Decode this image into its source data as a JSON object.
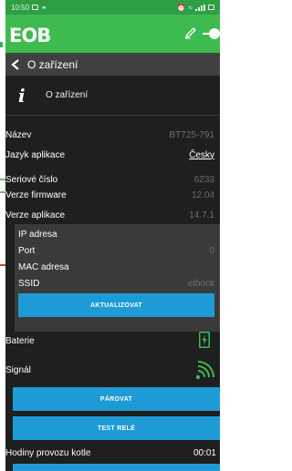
{
  "statusbar": {
    "time": "10:50"
  },
  "appbar": {
    "logo": "EOB"
  },
  "titlebar": {
    "title": "O zařízení"
  },
  "section": {
    "label": "O zařízení"
  },
  "info_rows": [
    {
      "key": "Název",
      "value": "BT725-791"
    },
    {
      "key": "Jazyk aplikace",
      "value": "Česky"
    },
    {
      "key": "Seriové číslo",
      "value": "6233"
    },
    {
      "key": "Verze firmware",
      "value": "12.04"
    },
    {
      "key": "Verze aplikace",
      "value": "14.7.1"
    }
  ],
  "network": {
    "ip_label": "IP adresa",
    "ip_value": "",
    "port_label": "Port",
    "port_value": "0",
    "mac_label": "MAC adresa",
    "mac_value": "",
    "ssid_label": "SSID",
    "ssid_value": "elbock",
    "update_button": "AKTUALIZOVAT"
  },
  "battery": {
    "label": "Baterie"
  },
  "signal": {
    "label": "Signál"
  },
  "buttons": {
    "pair": "PÁROVAT",
    "test_relay": "TEST RELÉ"
  },
  "boiler_hours": {
    "label": "Hodiny provozu kotle",
    "value": "00:01"
  },
  "colors": {
    "accent_green": "#3dbb4f",
    "button_blue": "#1e9bd7",
    "background": "#1f1f1f"
  }
}
